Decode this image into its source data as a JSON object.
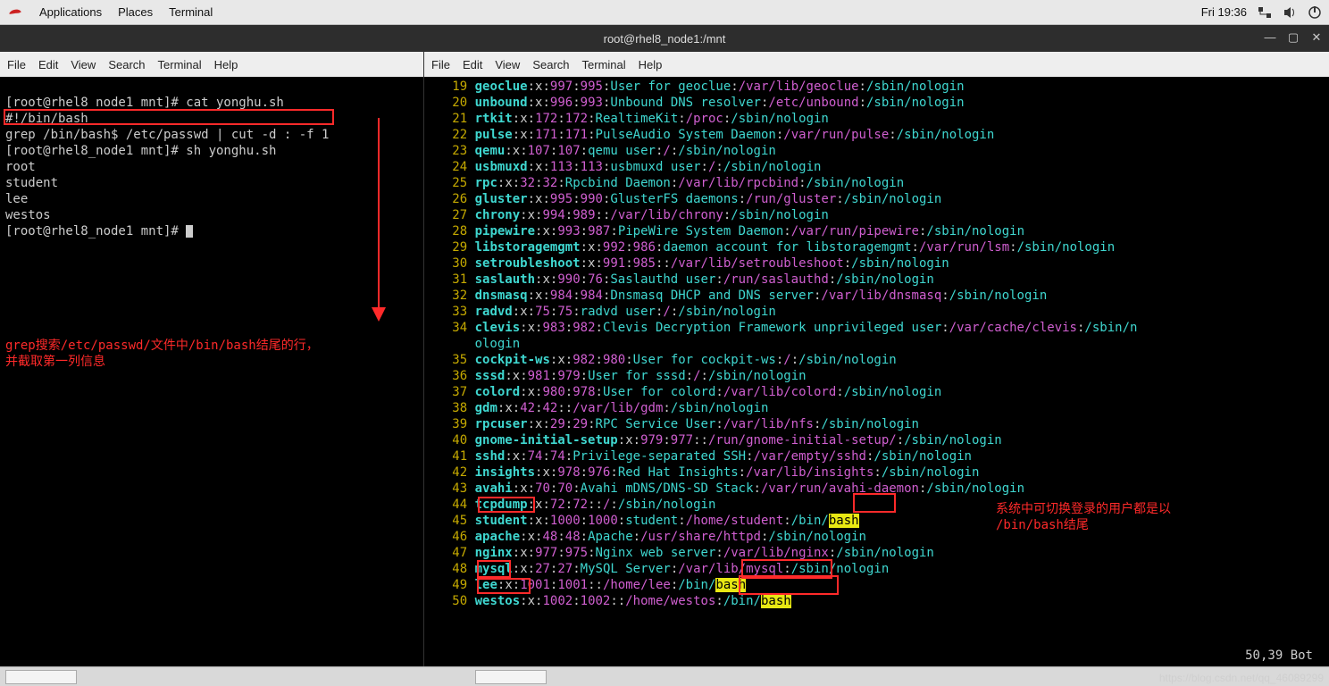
{
  "topbar": {
    "apps": "Applications",
    "places": "Places",
    "terminal": "Terminal",
    "time": "Fri 19:36"
  },
  "window": {
    "title": "root@rhel8_node1:/mnt",
    "minimize": "—",
    "maximize": "▢",
    "close": "✕"
  },
  "menu": {
    "file": "File",
    "edit": "Edit",
    "view": "View",
    "search": "Search",
    "terminal": "Terminal",
    "help": "Help"
  },
  "left": {
    "l1": "[root@rhel8_node1 mnt]# cat yonghu.sh",
    "l2": "#!/bin/bash",
    "l3": "grep /bin/bash$ /etc/passwd | cut -d : -f 1",
    "l4": "[root@rhel8_node1 mnt]# sh yonghu.sh",
    "l5": "root",
    "l6": "student",
    "l7": "lee",
    "l8": "westos",
    "l9": "[root@rhel8_node1 mnt]# "
  },
  "annot": {
    "left1": "grep搜索/etc/passwd/文件中/bin/bash结尾的行，",
    "left2": "并截取第一列信息",
    "right1": "系统中可切换登录的用户都是以",
    "right2": "/bin/bash结尾"
  },
  "status": {
    "pos": "50,39",
    "where": "Bot"
  },
  "watermark": "https://blog.csdn.net/qq_46089299",
  "lines": [
    {
      "n": 19,
      "u": "geoclue",
      "uid": "997",
      "gid": "995",
      "d": "User for geoclue",
      "p": "/var/lib/geoclue",
      "s": "/sbin/nologin"
    },
    {
      "n": 20,
      "u": "unbound",
      "uid": "996",
      "gid": "993",
      "d": "Unbound DNS resolver",
      "p": "/etc/unbound",
      "s": "/sbin/nologin"
    },
    {
      "n": 21,
      "u": "rtkit",
      "uid": "172",
      "gid": "172",
      "d": "RealtimeKit",
      "p": "/proc",
      "s": "/sbin/nologin"
    },
    {
      "n": 22,
      "u": "pulse",
      "uid": "171",
      "gid": "171",
      "d": "PulseAudio System Daemon",
      "p": "/var/run/pulse",
      "s": "/sbin/nologin"
    },
    {
      "n": 23,
      "u": "qemu",
      "uid": "107",
      "gid": "107",
      "d": "qemu user",
      "p": "/",
      "s": "/sbin/nologin"
    },
    {
      "n": 24,
      "u": "usbmuxd",
      "uid": "113",
      "gid": "113",
      "d": "usbmuxd user",
      "p": "/",
      "s": "/sbin/nologin"
    },
    {
      "n": 25,
      "u": "rpc",
      "uid": "32",
      "gid": "32",
      "d": "Rpcbind Daemon",
      "p": "/var/lib/rpcbind",
      "s": "/sbin/nologin"
    },
    {
      "n": 26,
      "u": "gluster",
      "uid": "995",
      "gid": "990",
      "d": "GlusterFS daemons",
      "p": "/run/gluster",
      "s": "/sbin/nologin"
    },
    {
      "n": 27,
      "u": "chrony",
      "uid": "994",
      "gid": "989",
      "d": "",
      "p": "/var/lib/chrony",
      "s": "/sbin/nologin"
    },
    {
      "n": 28,
      "u": "pipewire",
      "uid": "993",
      "gid": "987",
      "d": "PipeWire System Daemon",
      "p": "/var/run/pipewire",
      "s": "/sbin/nologin"
    },
    {
      "n": 29,
      "u": "libstoragemgmt",
      "uid": "992",
      "gid": "986",
      "d": "daemon account for libstoragemgmt",
      "p": "/var/run/lsm",
      "s": "/sbin/nologin"
    },
    {
      "n": 30,
      "u": "setroubleshoot",
      "uid": "991",
      "gid": "985",
      "d": "",
      "p": "/var/lib/setroubleshoot",
      "s": "/sbin/nologin"
    },
    {
      "n": 31,
      "u": "saslauth",
      "uid": "990",
      "gid": "76",
      "d": "Saslauthd user",
      "p": "/run/saslauthd",
      "s": "/sbin/nologin"
    },
    {
      "n": 32,
      "u": "dnsmasq",
      "uid": "984",
      "gid": "984",
      "d": "Dnsmasq DHCP and DNS server",
      "p": "/var/lib/dnsmasq",
      "s": "/sbin/nologin"
    },
    {
      "n": 33,
      "u": "radvd",
      "uid": "75",
      "gid": "75",
      "d": "radvd user",
      "p": "/",
      "s": "/sbin/nologin"
    },
    {
      "n": 34,
      "u": "clevis",
      "uid": "983",
      "gid": "982",
      "d": "Clevis Decryption Framework unprivileged user",
      "p": "/var/cache/clevis",
      "s": "/sbin/n",
      "wrap": "ologin"
    },
    {
      "n": 35,
      "u": "cockpit-ws",
      "uid": "982",
      "gid": "980",
      "d": "User for cockpit-ws",
      "p": "/",
      "s": "/sbin/nologin"
    },
    {
      "n": 36,
      "u": "sssd",
      "uid": "981",
      "gid": "979",
      "d": "User for sssd",
      "p": "/",
      "s": "/sbin/nologin"
    },
    {
      "n": 37,
      "u": "colord",
      "uid": "980",
      "gid": "978",
      "d": "User for colord",
      "p": "/var/lib/colord",
      "s": "/sbin/nologin"
    },
    {
      "n": 38,
      "u": "gdm",
      "uid": "42",
      "gid": "42",
      "d": "",
      "p": "/var/lib/gdm",
      "s": "/sbin/nologin"
    },
    {
      "n": 39,
      "u": "rpcuser",
      "uid": "29",
      "gid": "29",
      "d": "RPC Service User",
      "p": "/var/lib/nfs",
      "s": "/sbin/nologin"
    },
    {
      "n": 40,
      "u": "gnome-initial-setup",
      "uid": "979",
      "gid": "977",
      "d": "",
      "p": "/run/gnome-initial-setup/",
      "s": "/sbin/nologin"
    },
    {
      "n": 41,
      "u": "sshd",
      "uid": "74",
      "gid": "74",
      "d": "Privilege-separated SSH",
      "p": "/var/empty/sshd",
      "s": "/sbin/nologin"
    },
    {
      "n": 42,
      "u": "insights",
      "uid": "978",
      "gid": "976",
      "d": "Red Hat Insights",
      "p": "/var/lib/insights",
      "s": "/sbin/nologin"
    },
    {
      "n": 43,
      "u": "avahi",
      "uid": "70",
      "gid": "70",
      "d": "Avahi mDNS/DNS-SD Stack",
      "p": "/var/run/avahi-daemon",
      "s": "/sbin/nologin"
    },
    {
      "n": 44,
      "u": "tcpdump",
      "uid": "72",
      "gid": "72",
      "d": "",
      "p": "/",
      "s": "/sbin/nologin"
    },
    {
      "n": 45,
      "u": "student",
      "uid": "1000",
      "gid": "1000",
      "d": "student",
      "p": "/home/student",
      "s": "/bin/",
      "bash": true
    },
    {
      "n": 46,
      "u": "apache",
      "uid": "48",
      "gid": "48",
      "d": "Apache",
      "p": "/usr/share/httpd",
      "s": "/sbin/nologin"
    },
    {
      "n": 47,
      "u": "nginx",
      "uid": "977",
      "gid": "975",
      "d": "Nginx web server",
      "p": "/var/lib/nginx",
      "s": "/sbin/nologin"
    },
    {
      "n": 48,
      "u": "mysql",
      "uid": "27",
      "gid": "27",
      "d": "MySQL Server",
      "p": "/var/lib/mysql",
      "s": "/sbin/nologin"
    },
    {
      "n": 49,
      "u": "lee",
      "uid": "1001",
      "gid": "1001",
      "d": "",
      "p": "/home/lee",
      "s": "/bin/",
      "bash": true
    },
    {
      "n": 50,
      "u": "westos",
      "uid": "1002",
      "gid": "1002",
      "d": "",
      "p": "/home/westos",
      "s": "/bin/",
      "bash": true
    }
  ]
}
